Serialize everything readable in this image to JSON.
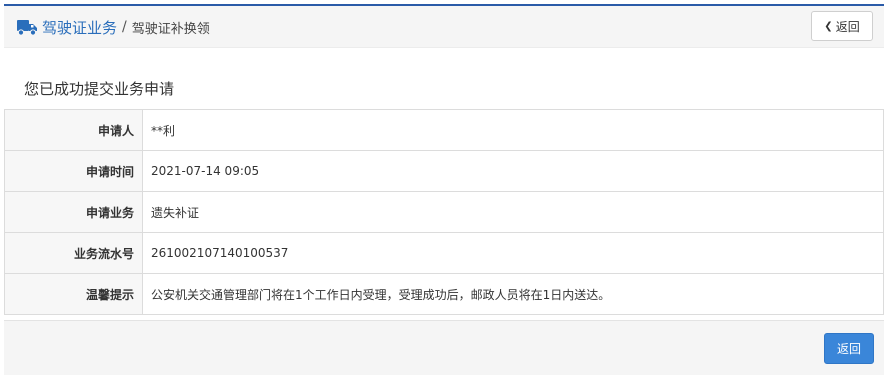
{
  "header": {
    "breadcrumb_main": "驾驶证业务",
    "breadcrumb_separator": "/",
    "breadcrumb_sub": "驾驶证补换领",
    "back_label": "返回",
    "icon": "truck-icon",
    "accent_color": "#2a6ebb"
  },
  "page": {
    "title": "您已成功提交业务申请"
  },
  "details": {
    "rows": [
      {
        "label": "申请人",
        "value": "**利"
      },
      {
        "label": "申请时间",
        "value": "2021-07-14 09:05"
      },
      {
        "label": "申请业务",
        "value": "遗失补证"
      },
      {
        "label": "业务流水号",
        "value": "261002107140100537"
      },
      {
        "label": "温馨提示",
        "value": "公安机关交通管理部门将在1个工作日内受理，受理成功后，邮政人员将在1日内送达。"
      }
    ]
  },
  "footer": {
    "back_label": "返回",
    "button_color": "#3a86d9"
  }
}
